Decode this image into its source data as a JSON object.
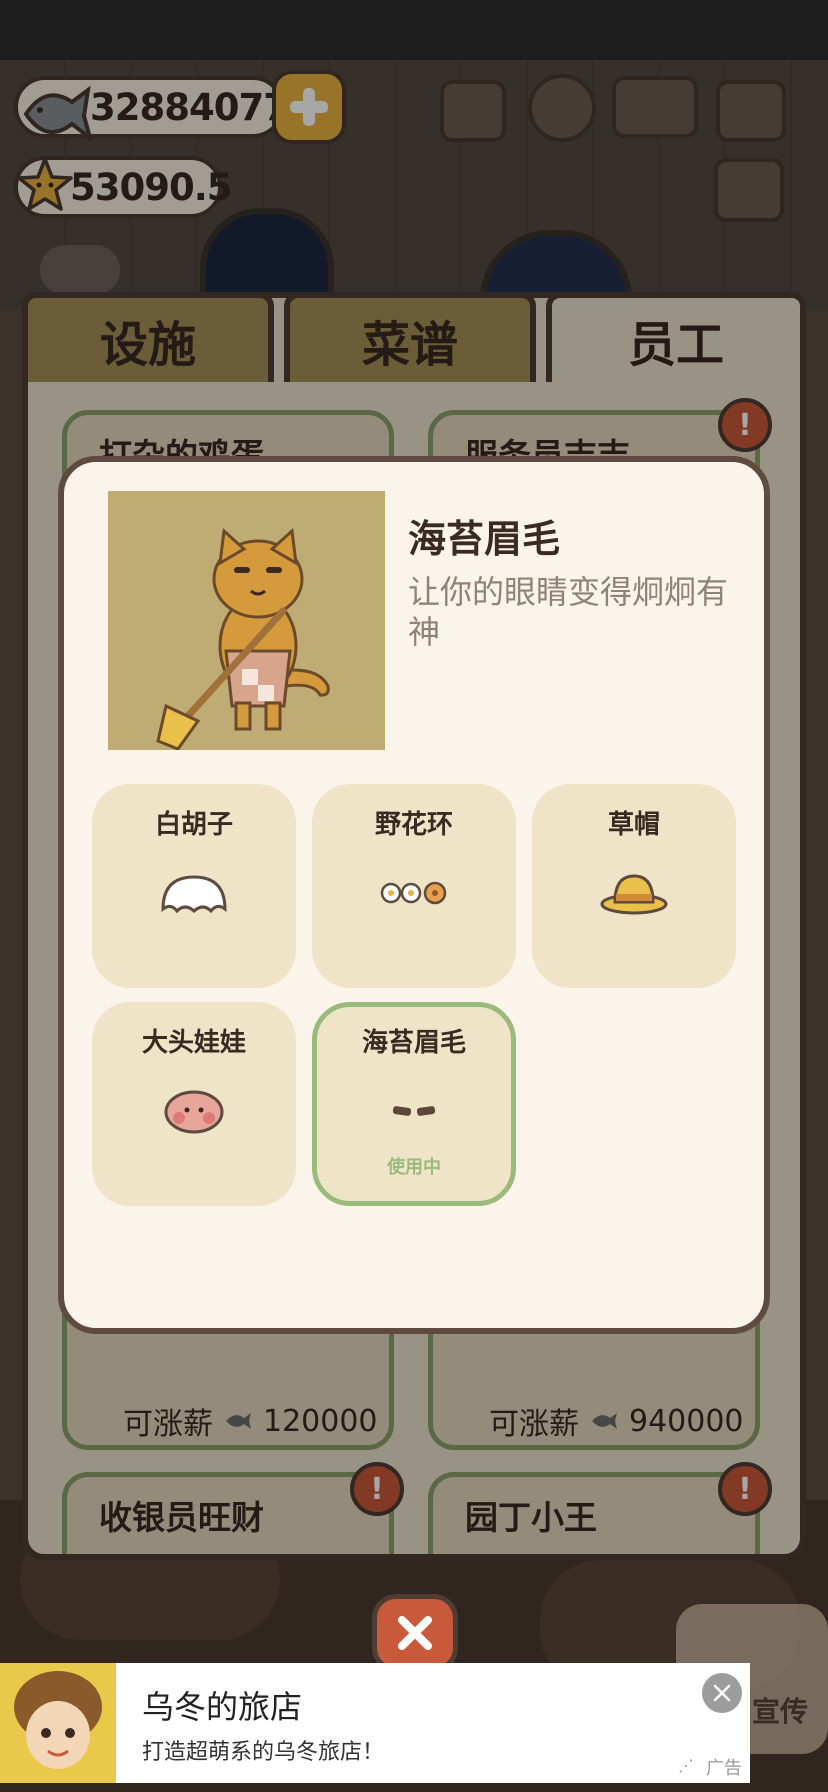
{
  "hud": {
    "fish": "32884077",
    "stars": "53090.5"
  },
  "tabs": [
    "设施",
    "菜谱",
    "员工"
  ],
  "staff": [
    {
      "name": "打杂的鸡蛋",
      "salary_label": "可涨薪",
      "salary": "120000"
    },
    {
      "name": "服务员吉吉",
      "salary_label": "可涨薪",
      "salary": "940000"
    },
    {
      "name": "收银员旺财"
    },
    {
      "name": "园丁小王"
    }
  ],
  "dialog": {
    "title": "海苔眉毛",
    "description": "让你的眼睛变得炯炯有神",
    "accessories": [
      {
        "name": "白胡子",
        "icon": "white-beard-icon"
      },
      {
        "name": "野花环",
        "icon": "flower-wreath-icon"
      },
      {
        "name": "草帽",
        "icon": "straw-hat-icon"
      },
      {
        "name": "大头娃娃",
        "icon": "big-head-doll-icon"
      },
      {
        "name": "海苔眉毛",
        "icon": "seaweed-eyebrows-icon",
        "status": "使用中"
      }
    ]
  },
  "ad": {
    "title": "乌冬的旅店",
    "subtitle": "打造超萌系的乌冬旅店！",
    "label": "广告"
  },
  "bottom_right": "宣传",
  "colors": {
    "panel": "#ece2cc",
    "dialog": "#fbf4ea",
    "active_border": "#9bbb7d",
    "tab_inactive": "#a38f55",
    "alert": "#c8593a"
  }
}
